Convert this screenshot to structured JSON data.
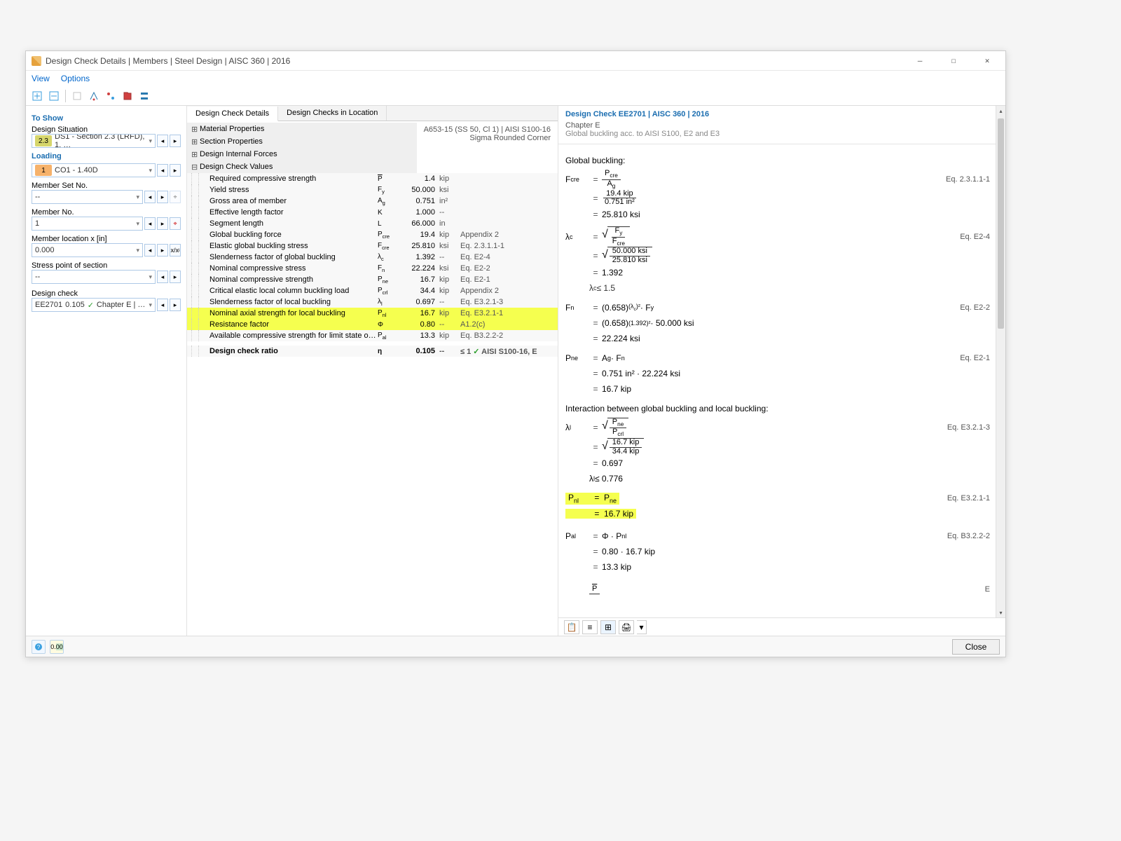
{
  "window": {
    "title": "Design Check Details | Members | Steel Design | AISC 360 | 2016",
    "minimize_label": "—",
    "maximize_label": "☐",
    "close_label": "✕"
  },
  "menu": {
    "view": "View",
    "options": "Options"
  },
  "left": {
    "to_show": "To Show",
    "design_situation": "Design Situation",
    "design_situation_value": "DS1 - Section 2.3 (LRFD), 1. …",
    "ds_badge": "2.3",
    "loading": "Loading",
    "loading_value": "CO1 - 1.40D",
    "loading_badge": "1",
    "member_set_no": "Member Set No.",
    "member_set_value": "--",
    "member_no": "Member No.",
    "member_value": "1",
    "member_location": "Member location x [in]",
    "member_location_value": "0.000",
    "stress_point": "Stress point of section",
    "stress_point_value": "--",
    "design_check": "Design check",
    "design_check_code": "EE2701",
    "design_check_ratio": "0.105",
    "design_check_text": "Chapter E | Gl…"
  },
  "mid": {
    "tab_details": "Design Check Details",
    "tab_location": "Design Checks in Location",
    "material_info": "A653-15 (SS 50, Cl 1) | AISI S100-16",
    "shape_info": "Sigma Rounded Corner",
    "sections": {
      "material": "Material Properties",
      "section": "Section Properties",
      "forces": "Design Internal Forces",
      "values": "Design Check Values"
    },
    "rows": [
      {
        "label": "Required compressive strength",
        "sym": "P̄",
        "sym_html": "<span class=\"overline\">P</span>",
        "val": "1.4",
        "unit": "kip",
        "ref": ""
      },
      {
        "label": "Yield stress",
        "sym": "Fy",
        "sym_html": "F<sub>y</sub>",
        "val": "50.000",
        "unit": "ksi",
        "ref": ""
      },
      {
        "label": "Gross area of member",
        "sym": "Ag",
        "sym_html": "A<sub>g</sub>",
        "val": "0.751",
        "unit": "in²",
        "ref": ""
      },
      {
        "label": "Effective length factor",
        "sym": "K",
        "sym_html": "K",
        "val": "1.000",
        "unit": "--",
        "ref": ""
      },
      {
        "label": "Segment length",
        "sym": "L",
        "sym_html": "L",
        "val": "66.000",
        "unit": "in",
        "ref": ""
      },
      {
        "label": "Global buckling force",
        "sym": "Pcre",
        "sym_html": "P<sub>cre</sub>",
        "val": "19.4",
        "unit": "kip",
        "ref": "Appendix 2"
      },
      {
        "label": "Elastic global buckling stress",
        "sym": "Fcre",
        "sym_html": "F<sub>cre</sub>",
        "val": "25.810",
        "unit": "ksi",
        "ref": "Eq. 2.3.1.1-1"
      },
      {
        "label": "Slenderness factor of global buckling",
        "sym": "λc",
        "sym_html": "λ<sub>c</sub>",
        "val": "1.392",
        "unit": "--",
        "ref": "Eq. E2-4"
      },
      {
        "label": "Nominal compressive stress",
        "sym": "Fn",
        "sym_html": "F<sub>n</sub>",
        "val": "22.224",
        "unit": "ksi",
        "ref": "Eq. E2-2"
      },
      {
        "label": "Nominal compressive strength",
        "sym": "Pne",
        "sym_html": "P<sub>ne</sub>",
        "val": "16.7",
        "unit": "kip",
        "ref": "Eq. E2-1"
      },
      {
        "label": "Critical elastic local column buckling load",
        "sym": "Pcrl",
        "sym_html": "P<sub>crl</sub>",
        "val": "34.4",
        "unit": "kip",
        "ref": "Appendix 2"
      },
      {
        "label": "Slenderness factor of local buckling",
        "sym": "λl",
        "sym_html": "λ<sub>l</sub>",
        "val": "0.697",
        "unit": "--",
        "ref": "Eq. E3.2.1-3"
      },
      {
        "label": "Nominal axial strength for local buckling",
        "sym": "Pnl",
        "sym_html": "P<sub>nl</sub>",
        "val": "16.7",
        "unit": "kip",
        "ref": "Eq. E3.2.1-1",
        "hl": true
      },
      {
        "label": "Resistance factor",
        "sym": "Φ",
        "sym_html": "Φ",
        "val": "0.80",
        "unit": "--",
        "ref": "A1.2(c)",
        "hl": true
      },
      {
        "label": "Available compressive strength for limit state of local buckling",
        "sym": "Pal",
        "sym_html": "P<sub>al</sub>",
        "val": "13.3",
        "unit": "kip",
        "ref": "Eq. B3.2.2-2"
      }
    ],
    "ratio_row": {
      "label": "Design check ratio",
      "sym": "η",
      "val": "0.105",
      "unit": "--",
      "limit": "≤ 1",
      "status": "✓",
      "ref": "AISI S100-16, E"
    }
  },
  "right": {
    "header": "Design Check EE2701 | AISC 360 | 2016",
    "chapter": "Chapter E",
    "chapter_sub": "Global buckling acc. to AISI S100, E2 and E3",
    "section_title": "Global buckling:",
    "eq_2_3_1_1_1": "Eq. 2.3.1.1-1",
    "eq_e2_4": "Eq. E2-4",
    "eq_e2_2": "Eq. E2-2",
    "eq_e2_1": "Eq. E2-1",
    "interaction_title": "Interaction between global buckling and local buckling:",
    "eq_e3_2_1_3": "Eq. E3.2.1-3",
    "eq_e3_2_1_1": "Eq. E3.2.1-1",
    "eq_b3_2_2_2": "Eq. B3.2.2-2",
    "letter_e": "E",
    "Fcre": "F_cre",
    "Pcre": "P_cre",
    "Ag": "A_g",
    "v_pcre": "19.4 kip",
    "v_ag": "0.751 in²",
    "v_fcre": "25.810 ksi",
    "lambda_c": "λ_c",
    "Fy": "F_y",
    "v_fy": "50.000 ksi",
    "v_lambda_c": "1.392",
    "cond_lambda_c": "λ_c ≤ 1.5",
    "Fn": "F_n",
    "expr_fn": "(0.658)^(λc)² · F_y",
    "expr_fn_num": "(0.658)^(1.392)² · 50.000 ksi",
    "v_fn": "22.224 ksi",
    "Pne": "P_ne",
    "expr_pne": "A_g · F_n",
    "expr_pne_num": "0.751 in² · 22.224 ksi",
    "v_pne": "16.7 kip",
    "lambda_l": "λ_l",
    "Pcrl": "P_crl",
    "v_pne2": "16.7 kip",
    "v_pcrl": "34.4 kip",
    "v_lambda_l": "0.697",
    "cond_lambda_l": "λ_l ≤ 0.776",
    "Pnl": "P_nl",
    "pnl_eq_pne": "P_ne",
    "v_pnl": "16.7 kip",
    "Pal": "P_al",
    "expr_pal": "Φ · P_nl",
    "expr_pal_num": "0.80 · 16.7 kip",
    "v_pal": "13.3 kip",
    "Pbar": "P̄"
  },
  "footer": {
    "close": "Close"
  }
}
